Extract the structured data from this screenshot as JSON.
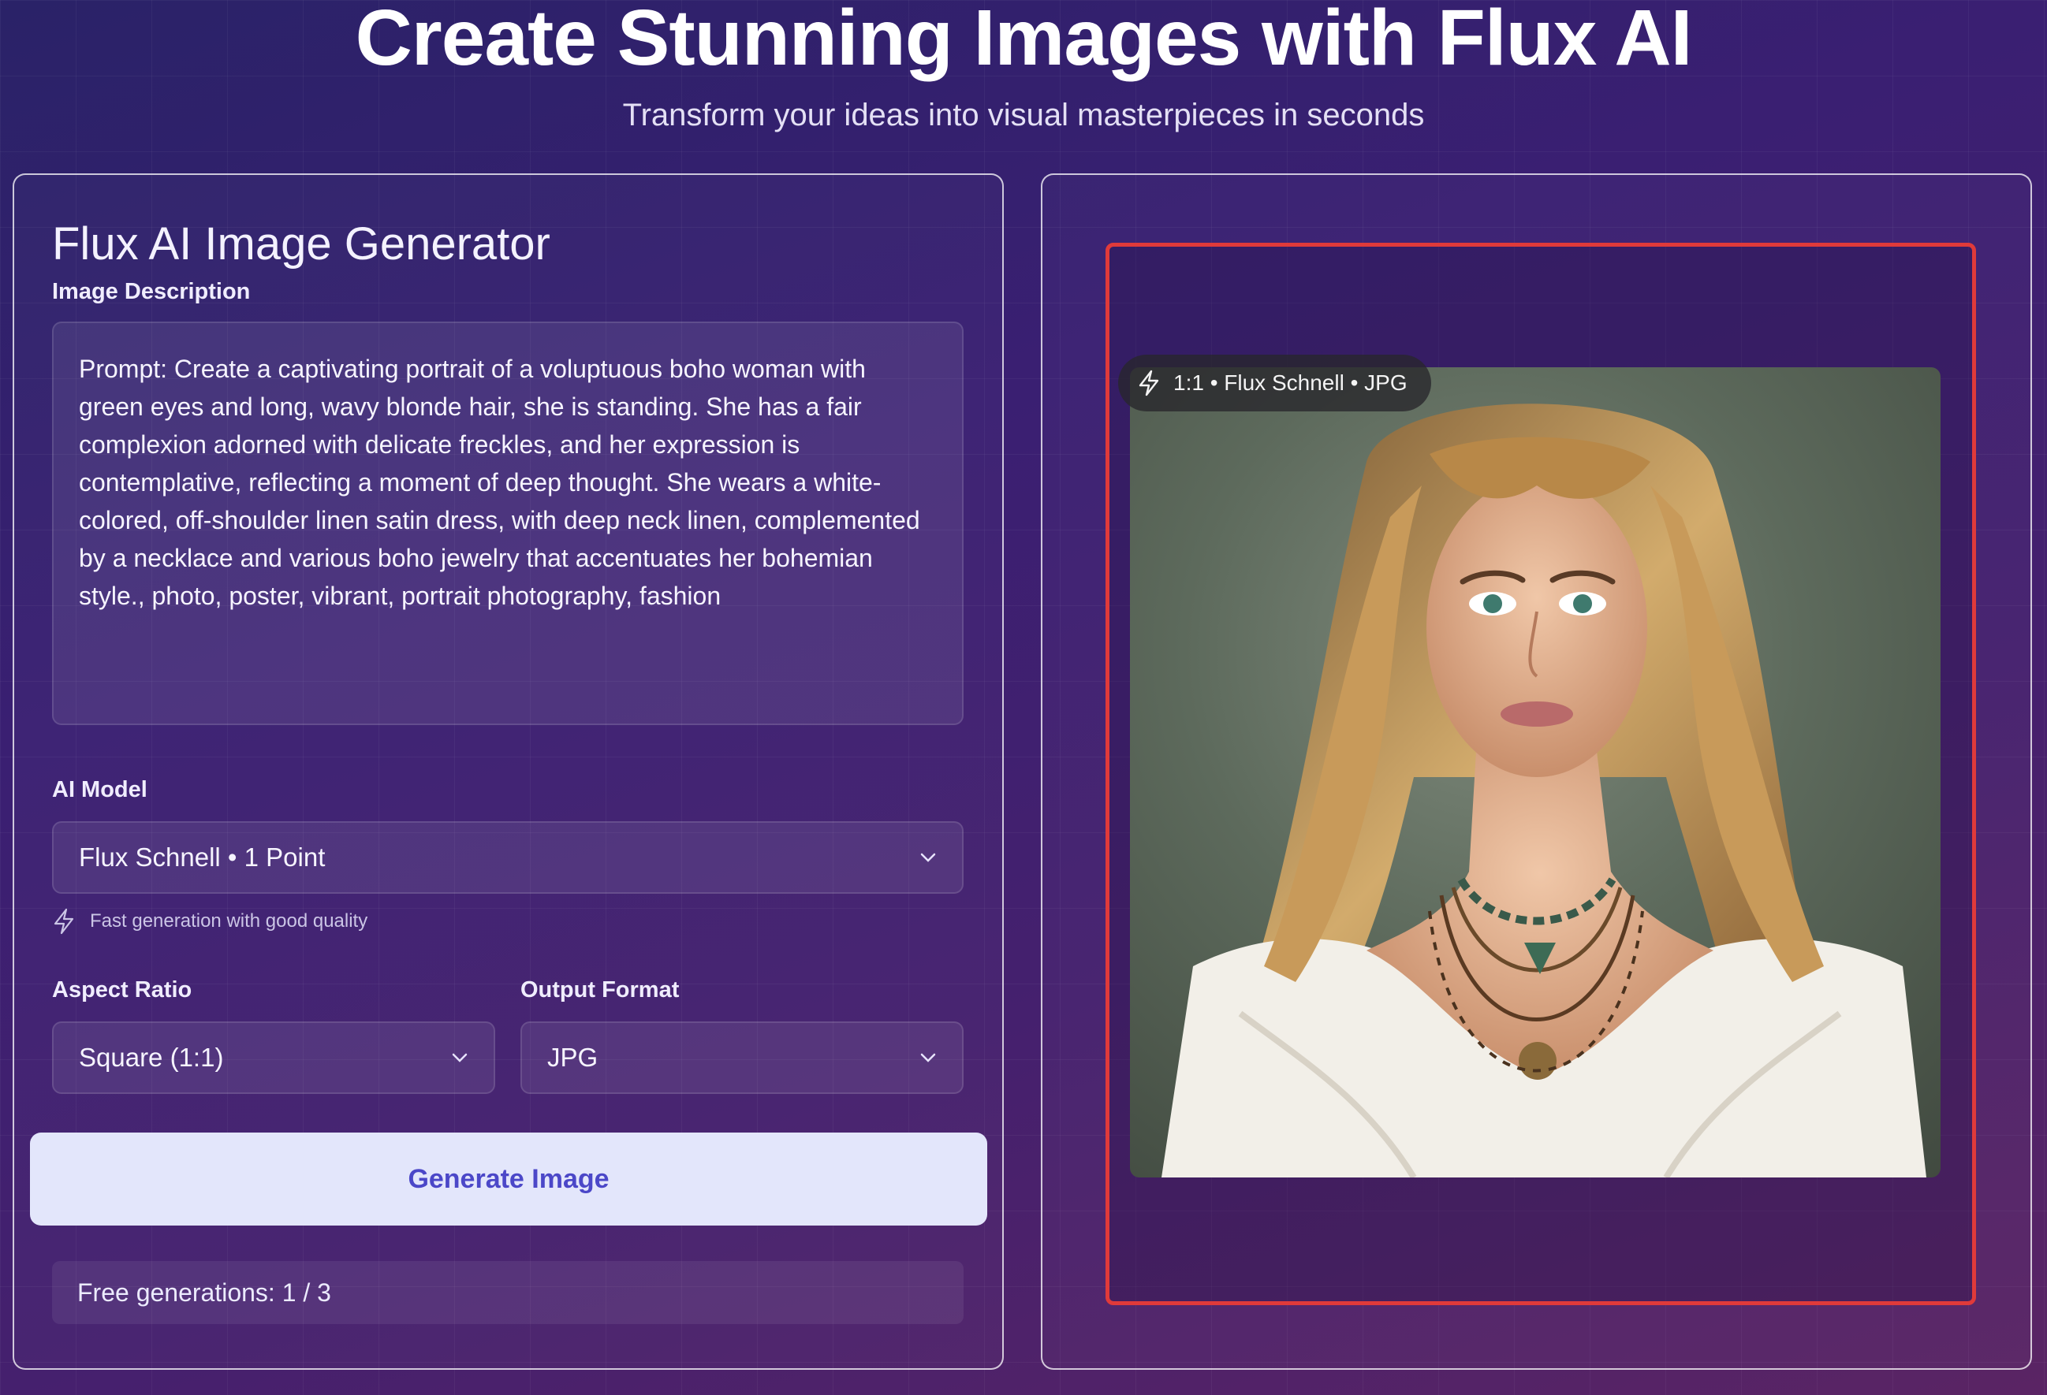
{
  "header": {
    "title": "Create Stunning Images with Flux AI",
    "subtitle": "Transform your ideas into visual masterpieces in seconds"
  },
  "form": {
    "title": "Flux AI Image Generator",
    "description_label": "Image Description",
    "prompt": "Prompt: Create a captivating portrait of a voluptuous boho woman with green eyes and long, wavy blonde hair, she is standing. She has a fair complexion adorned with delicate freckles, and her expression is contemplative, reflecting a moment of deep thought. She wears a white-colored, off-shoulder linen satin dress, with deep neck linen, complemented by a necklace and various boho jewelry that accentuates her bohemian style., photo, poster, vibrant, portrait photography, fashion",
    "model_label": "AI Model",
    "model_value": "Flux Schnell • 1 Point",
    "model_hint": "Fast generation with good quality",
    "aspect_label": "Aspect Ratio",
    "aspect_value": "Square (1:1)",
    "format_label": "Output Format",
    "format_value": "JPG",
    "generate_label": "Generate Image",
    "free_generations": "Free generations: 1 / 3"
  },
  "preview": {
    "badge": "1:1 • Flux Schnell • JPG",
    "badge_icon": "lightning-icon",
    "frame_color": "#e03a3a"
  },
  "colors": {
    "button_bg": "#e3e6fb",
    "button_text": "#4b47c8"
  }
}
